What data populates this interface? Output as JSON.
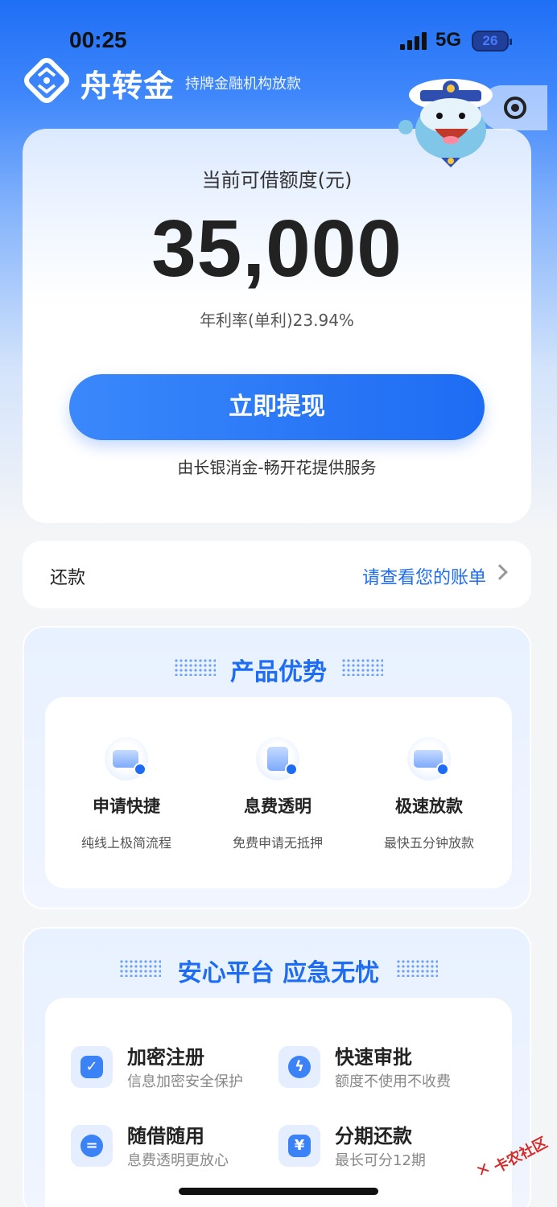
{
  "status_bar": {
    "time": "00:25",
    "network": "5G",
    "battery": "26"
  },
  "brand": {
    "name": "舟转金",
    "tagline": "持牌金融机构放款"
  },
  "credit": {
    "limit_label": "当前可借额度(元)",
    "limit_value": "35,000",
    "rate": "年利率(单利)23.94%",
    "withdraw_button": "立即提现",
    "provider": "由长银消金-畅开花提供服务"
  },
  "repay": {
    "label": "还款",
    "link": "请查看您的账单"
  },
  "advantages": {
    "title": "产品优势",
    "items": [
      {
        "title": "申请快捷",
        "desc": "纯线上极简流程",
        "icon": "card-icon"
      },
      {
        "title": "息费透明",
        "desc": "免费申请无抵押",
        "icon": "document-icon"
      },
      {
        "title": "极速放款",
        "desc": "最快五分钟放款",
        "icon": "wallet-icon"
      }
    ]
  },
  "assurance": {
    "title": "安心平台 应急无忧",
    "items": [
      {
        "title": "加密注册",
        "desc": "信息加密安全保护",
        "icon": "shield-check-icon"
      },
      {
        "title": "快速审批",
        "desc": "额度不使用不收费",
        "icon": "lightning-icon"
      },
      {
        "title": "随借随用",
        "desc": "息费透明更放心",
        "icon": "bill-icon",
        "glyph": "="
      },
      {
        "title": "分期还款",
        "desc": "最长可分12期",
        "icon": "yen-ticket-icon",
        "glyph": "¥"
      }
    ]
  },
  "watermark": {
    "text": "卡农社区"
  },
  "colors": {
    "accent": "#1e6cf3",
    "brand_blue": "#3a88fb"
  }
}
